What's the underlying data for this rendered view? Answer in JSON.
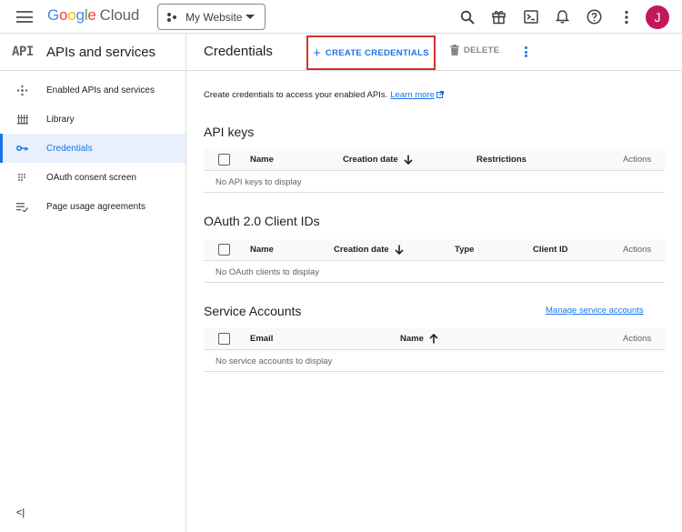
{
  "topbar": {
    "logo_google": [
      "G",
      "o",
      "o",
      "g",
      "l",
      "e"
    ],
    "logo_cloud": "Cloud",
    "project_name": "My Website",
    "avatar_letter": "J"
  },
  "sidebar": {
    "api_badge": "API",
    "title": "APIs and services",
    "items": [
      {
        "label": "Enabled APIs and services",
        "icon": "enabled-apis-icon"
      },
      {
        "label": "Library",
        "icon": "library-icon"
      },
      {
        "label": "Credentials",
        "icon": "key-icon",
        "active": true
      },
      {
        "label": "OAuth consent screen",
        "icon": "oauth-consent-icon"
      },
      {
        "label": "Page usage agreements",
        "icon": "page-usage-icon"
      }
    ],
    "collapse_glyph": "<|"
  },
  "main": {
    "title": "Credentials",
    "create_label": "CREATE CREDENTIALS",
    "delete_label": "DELETE",
    "intro_text": "Create credentials to access your enabled APIs.",
    "learn_more": "Learn more",
    "sections": {
      "api_keys": {
        "title": "API keys",
        "columns": [
          "Name",
          "Creation date",
          "Restrictions",
          "Actions"
        ],
        "empty": "No API keys to display"
      },
      "oauth": {
        "title": "OAuth 2.0 Client IDs",
        "columns": [
          "Name",
          "Creation date",
          "Type",
          "Client ID",
          "Actions"
        ],
        "empty": "No OAuth clients to display"
      },
      "service": {
        "title": "Service Accounts",
        "manage_link": "Manage service accounts",
        "columns": [
          "Email",
          "Name",
          "Actions"
        ],
        "empty": "No service accounts to display"
      }
    }
  },
  "colors": {
    "accent": "#1a73e8",
    "highlight_border": "#d32f2f",
    "avatar_bg": "#c2185b"
  }
}
